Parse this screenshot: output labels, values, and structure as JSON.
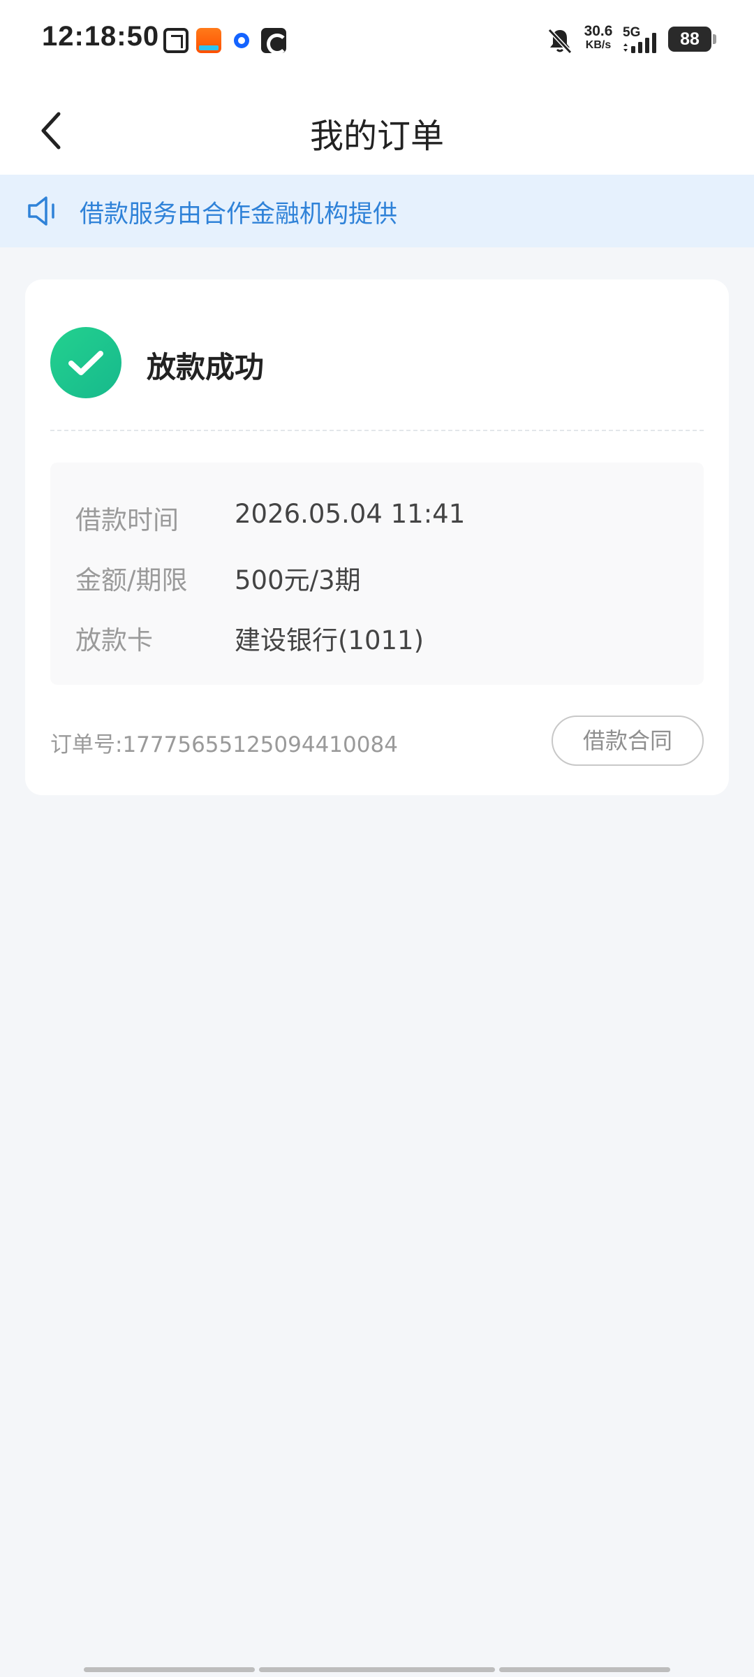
{
  "status_bar": {
    "time": "12:18:50",
    "net_speed_value": "30.6",
    "net_speed_unit": "KB/s",
    "network_type": "5G",
    "battery": "88",
    "icons": [
      "meituan-app-icon",
      "taobao-flash-app-icon",
      "blue-ring-app-icon",
      "cc-app-icon",
      "bell-muted-icon",
      "signal-icon"
    ]
  },
  "header": {
    "title": "我的订单"
  },
  "notice": {
    "text": "借款服务由合作金融机构提供"
  },
  "order": {
    "status": "放款成功",
    "details": [
      {
        "label": "借款时间",
        "value": "2026.05.04 11:41"
      },
      {
        "label": "金额/期限",
        "value": "500元/3期"
      },
      {
        "label": "放款卡",
        "value": "建设银行(1011)"
      }
    ],
    "order_no_label": "订单号:",
    "order_no": "17775655125094410084",
    "contract_button": "借款合同"
  },
  "colors": {
    "accent_blue": "#2f82d8",
    "success_green": "#1ec48f",
    "notice_bg": "#e6f1fd",
    "page_bg": "#f4f6f9"
  }
}
